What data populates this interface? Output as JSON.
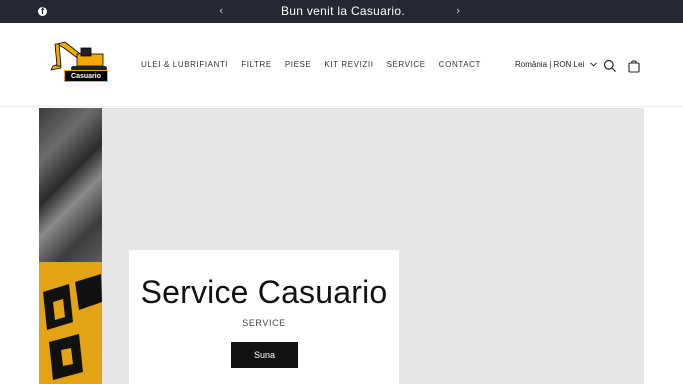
{
  "announcement": {
    "message": "Bun venit la Casuario.",
    "prev_icon": "‹",
    "next_icon": "›",
    "social_icon": "facebook-icon"
  },
  "header": {
    "logo_text": "Casuario",
    "nav": [
      {
        "label": "ULEI & LUBRIFIANTI"
      },
      {
        "label": "FILTRE"
      },
      {
        "label": "PIESE"
      },
      {
        "label": "KIT REVIZII"
      },
      {
        "label": "SERVICE"
      },
      {
        "label": "CONTACT"
      }
    ],
    "locale_label": "România | RON Lei",
    "icons": [
      "search-icon",
      "cart-icon",
      "chevron-down-icon"
    ]
  },
  "hero": {
    "title": "Service Casuario",
    "subtitle": "SERVICE",
    "button_label": "Suna"
  },
  "colors": {
    "announcement_bg": "#242833",
    "hero_bg": "#e6e6e6",
    "button_bg": "#121212",
    "logo_accent": "#f2a900"
  }
}
